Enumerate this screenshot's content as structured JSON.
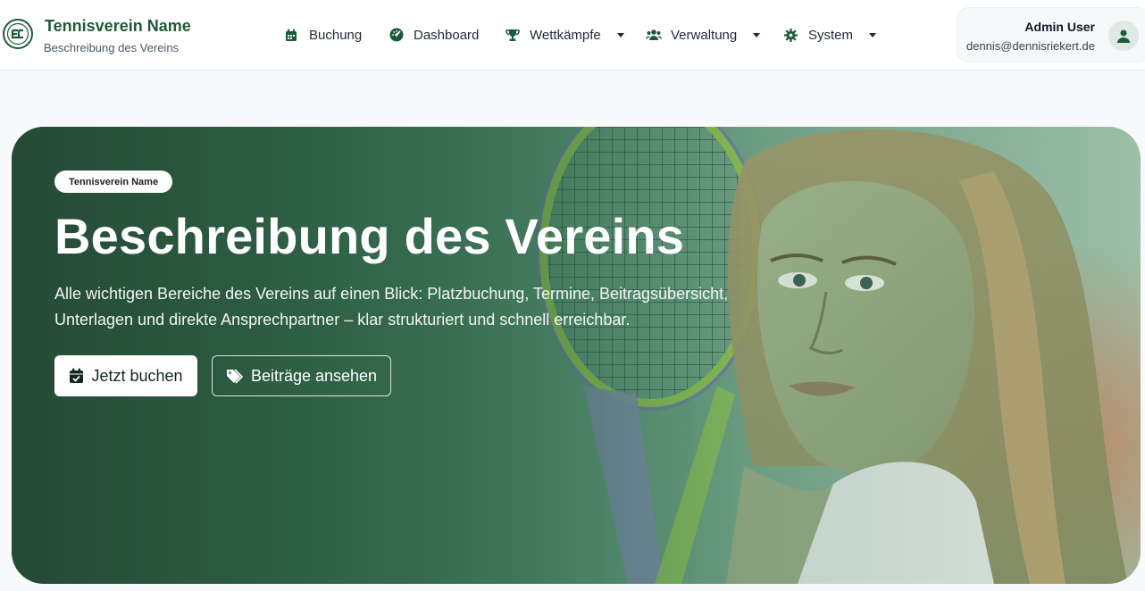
{
  "brand": {
    "title": "Tennisverein Name",
    "subtitle": "Beschreibung des Vereins",
    "color": "#1d5a37"
  },
  "nav": {
    "items": [
      {
        "label": "Buchung",
        "icon": "calendar-icon",
        "dropdown": false
      },
      {
        "label": "Dashboard",
        "icon": "gauge-icon",
        "dropdown": false
      },
      {
        "label": "Wettkämpfe",
        "icon": "trophy-icon",
        "dropdown": true
      },
      {
        "label": "Verwaltung",
        "icon": "users-icon",
        "dropdown": true
      },
      {
        "label": "System",
        "icon": "gear-icon",
        "dropdown": true
      }
    ]
  },
  "user": {
    "name": "Admin User",
    "email": "dennis@dennisriekert.de",
    "icon": "user-icon"
  },
  "hero": {
    "badge": "Tennisverein Name",
    "title": "Beschreibung des Vereins",
    "text": "Alle wichtigen Bereiche des Vereins auf einen Blick: Platzbuchung, Termine, Beitragsübersicht, Unterlagen und direkte Ansprechpartner – klar strukturiert und schnell erreichbar.",
    "primary_button": {
      "label": "Jetzt buchen",
      "icon": "calendar-check-icon"
    },
    "secondary_button": {
      "label": "Beiträge ansehen",
      "icon": "tags-icon"
    },
    "image": "tennis-player-with-racket-photo"
  }
}
